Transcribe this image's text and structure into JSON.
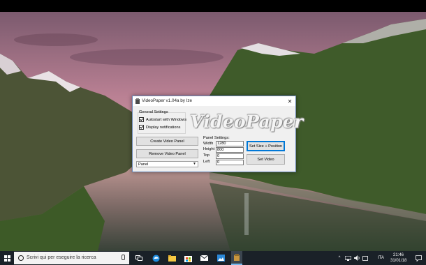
{
  "window": {
    "title": "VideoPaper v1.04a by Ize",
    "logo_text": "VideoPaper",
    "general_settings": {
      "label": "General Settings",
      "autostart_label": "Autostart with Windows",
      "autostart_checked": true,
      "notifications_label": "Display notifications",
      "notifications_checked": true
    },
    "buttons": {
      "create": "Create Video Panel",
      "remove": "Remove Video Panel",
      "set_size": "Set Size + Position",
      "set_video": "Set Video"
    },
    "panel_select": {
      "value": "Panel"
    },
    "panel_settings": {
      "label": "Panel Settings:",
      "width_label": "Width",
      "width_value": "1280",
      "height_label": "Height",
      "height_value": "800",
      "top_label": "Top",
      "top_value": "0",
      "left_label": "Left",
      "left_value": "0"
    }
  },
  "taskbar": {
    "search_placeholder": "Scrivi qui per eseguire la ricerca",
    "language": "ITA",
    "time": "21:46",
    "date": "31/01/18",
    "icons": [
      "task-view-icon",
      "edge-icon",
      "file-explorer-icon",
      "store-icon",
      "mail-icon",
      "photos-icon",
      "videopaper-taskbar-icon"
    ]
  },
  "colors": {
    "taskbar": "#1a2128",
    "accent": "#0078d7",
    "window_bg": "#f0f0f0"
  }
}
